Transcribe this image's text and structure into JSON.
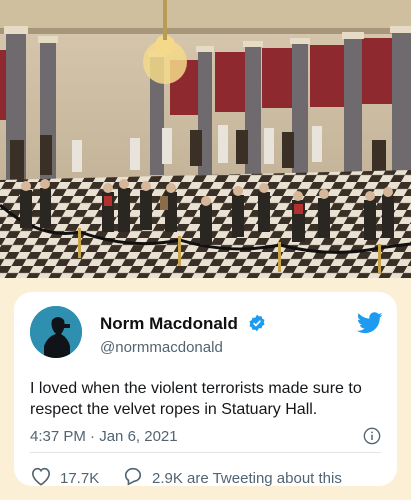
{
  "photo": {
    "alt_subject": "statuary-hall-photo"
  },
  "tweet": {
    "display_name": "Norm Macdonald",
    "handle": "@normmacdonald",
    "text": "I loved when the violent terrorists made sure to respect the velvet ropes in Statuary Hall.",
    "time": "4:37 PM",
    "separator": " · ",
    "date": "Jan 6, 2021",
    "likes": "17.7K",
    "tweeting": "2.9K are Tweeting about this"
  },
  "colors": {
    "twitter_blue": "#1d9bf0",
    "verified": "#1d9bf0",
    "panel_bg": "#fbf0d6"
  },
  "icons": [
    "verified-badge-icon",
    "twitter-bird-icon",
    "info-icon",
    "heart-icon",
    "reply-bubble-icon"
  ]
}
